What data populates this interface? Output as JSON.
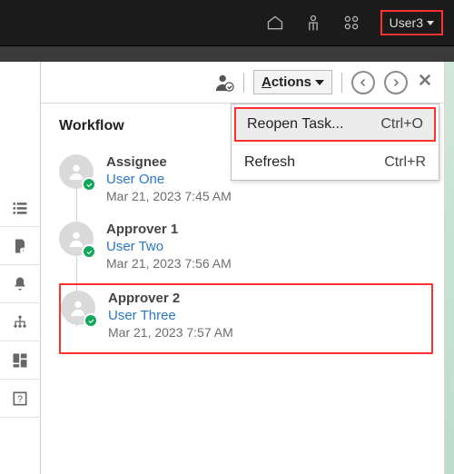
{
  "topbar": {
    "user_label": "User3"
  },
  "toolbar": {
    "actions_label": "Actions"
  },
  "menu": {
    "items": [
      {
        "label": "Reopen Task...",
        "kbd": "Ctrl+O",
        "highlight": true
      },
      {
        "label": "Refresh",
        "kbd": "Ctrl+R",
        "highlight": false
      }
    ]
  },
  "workflow": {
    "title": "Workflow",
    "items": [
      {
        "role": "Assignee",
        "user": "User One",
        "time": "Mar 21, 2023 7:45 AM",
        "boxed": false
      },
      {
        "role": "Approver 1",
        "user": "User Two",
        "time": "Mar 21, 2023 7:56 AM",
        "boxed": false
      },
      {
        "role": "Approver 2",
        "user": "User Three",
        "time": "Mar 21, 2023 7:57 AM",
        "boxed": true
      }
    ]
  }
}
